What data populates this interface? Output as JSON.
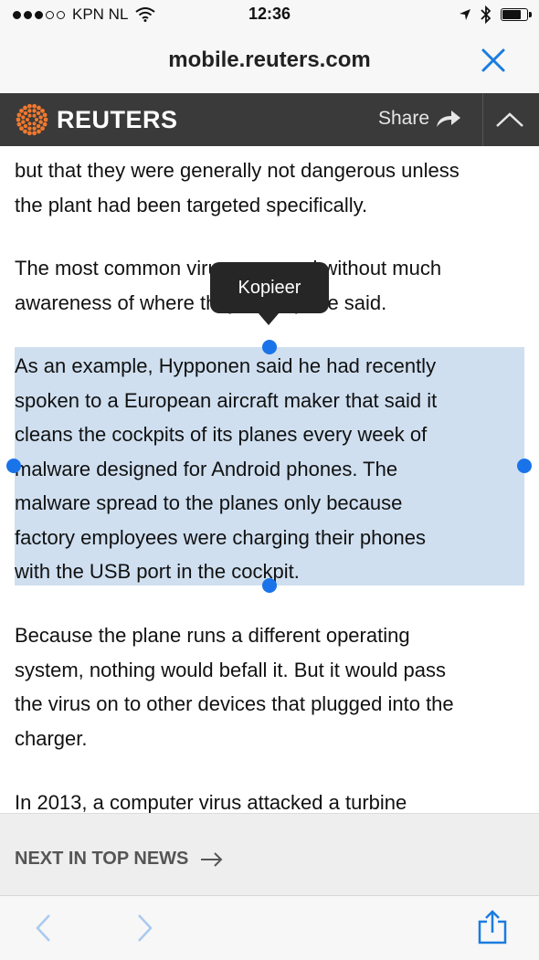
{
  "status_bar": {
    "carrier": "KPN NL",
    "time": "12:36",
    "signal_dots_filled": 3,
    "signal_dots_total": 5,
    "battery_level": 0.8
  },
  "url_bar": {
    "url": "mobile.reuters.com"
  },
  "header": {
    "brand": "REUTERS",
    "share_label": "Share",
    "brand_color": "#f0782d"
  },
  "article": {
    "p1_lines": [
      "but that they were generally not dangerous unless",
      "the plant had been targeted specifically."
    ],
    "p2_lines": [
      "The most common viruses spread without much",
      "awareness of where they end up, he said."
    ],
    "p3_lines": [
      "As an example, Hypponen said he had recently",
      "spoken to a European aircraft maker that said it",
      "cleans the cockpits of its planes every week of",
      "malware designed for Android phones. The",
      "malware spread to the planes only because",
      "factory employees were charging their phones",
      "with the USB port in the cockpit."
    ],
    "p4_lines": [
      "Because the plane runs a different operating",
      "system, nothing would befall it. But it would pass",
      "the virus on to other devices that plugged into the",
      "charger."
    ],
    "p5_lines": [
      "In 2013, a computer virus attacked a turbine"
    ]
  },
  "context_menu": {
    "copy_label": "Kopieer"
  },
  "next_news": {
    "label": "NEXT IN TOP NEWS"
  },
  "colors": {
    "selection": "#cfdff0",
    "handle": "#1a73e8",
    "ios_blue": "#1a7ce0"
  }
}
